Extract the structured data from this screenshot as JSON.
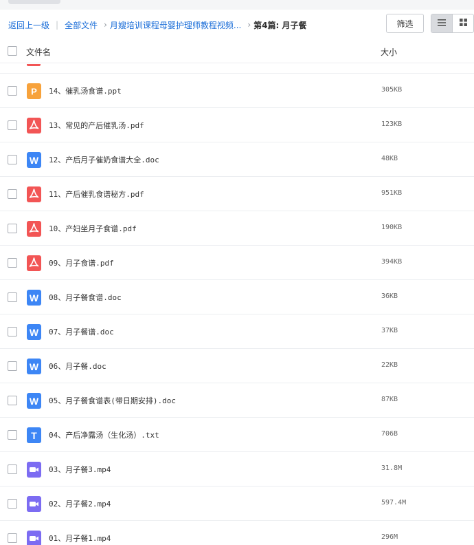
{
  "breadcrumb": {
    "back": "返回上一级",
    "separator": "|",
    "all_files": "全部文件",
    "arrow": "›",
    "course": "月嫂培训课程母婴护理师教程视频...",
    "current": "第4篇: 月子餐"
  },
  "toolbar": {
    "filter_label": "筛选"
  },
  "columns": {
    "name": "文件名",
    "size": "大小"
  },
  "files": [
    {
      "name": "14、催乳汤食谱.ppt",
      "size": "305KB",
      "type": "ppt",
      "glyph": "P",
      "color": "#f7a23b"
    },
    {
      "name": "13、常见的产后催乳汤.pdf",
      "size": "123KB",
      "type": "pdf",
      "glyph": "",
      "color": "#f25555"
    },
    {
      "name": "12、产后月子催奶食谱大全.doc",
      "size": "48KB",
      "type": "doc",
      "glyph": "W",
      "color": "#3d86f5"
    },
    {
      "name": "11、产后催乳食谱秘方.pdf",
      "size": "951KB",
      "type": "pdf",
      "glyph": "",
      "color": "#f25555"
    },
    {
      "name": "10、产妇坐月子食谱.pdf",
      "size": "190KB",
      "type": "pdf",
      "glyph": "",
      "color": "#f25555"
    },
    {
      "name": "09、月子食谱.pdf",
      "size": "394KB",
      "type": "pdf",
      "glyph": "",
      "color": "#f25555"
    },
    {
      "name": "08、月子餐食谱.doc",
      "size": "36KB",
      "type": "doc",
      "glyph": "W",
      "color": "#3d86f5"
    },
    {
      "name": "07、月子餐谱.doc",
      "size": "37KB",
      "type": "doc",
      "glyph": "W",
      "color": "#3d86f5"
    },
    {
      "name": "06、月子餐.doc",
      "size": "22KB",
      "type": "doc",
      "glyph": "W",
      "color": "#3d86f5"
    },
    {
      "name": "05、月子餐食谱表(带日期安排).doc",
      "size": "87KB",
      "type": "doc",
      "glyph": "W",
      "color": "#3d86f5"
    },
    {
      "name": "04、产后净露汤（生化汤）.txt",
      "size": "706B",
      "type": "txt",
      "glyph": "T",
      "color": "#3d86f5"
    },
    {
      "name": "03、月子餐3.mp4",
      "size": "31.8M",
      "type": "video",
      "glyph": "",
      "color": "#7c6cf2"
    },
    {
      "name": "02、月子餐2.mp4",
      "size": "597.4M",
      "type": "video",
      "glyph": "",
      "color": "#7c6cf2"
    },
    {
      "name": "01、月子餐1.mp4",
      "size": "296M",
      "type": "video",
      "glyph": "",
      "color": "#7c6cf2"
    }
  ]
}
